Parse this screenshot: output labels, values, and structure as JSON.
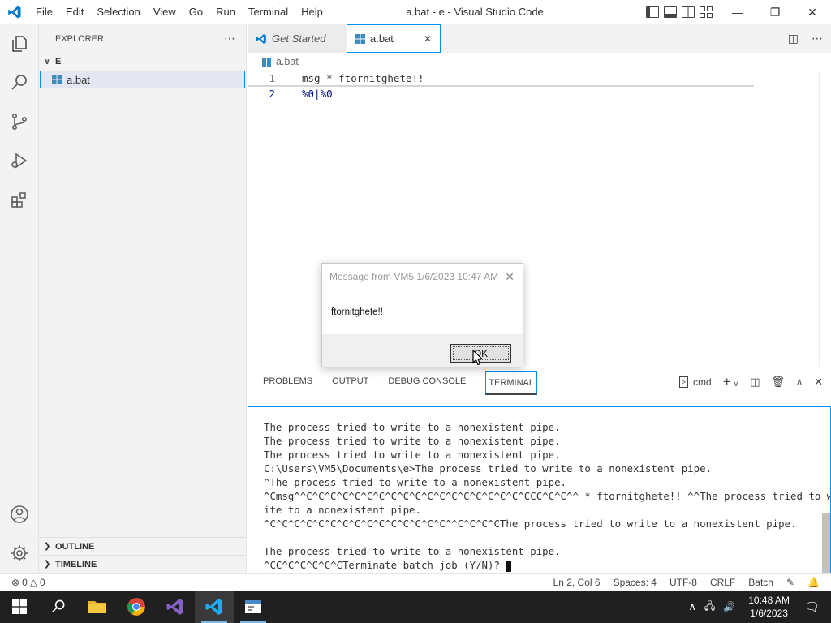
{
  "titlebar": {
    "menu": [
      "File",
      "Edit",
      "Selection",
      "View",
      "Go",
      "Run",
      "Terminal",
      "Help"
    ],
    "window_title": "a.bat - e - Visual Studio Code"
  },
  "sidebar": {
    "header": "EXPLORER",
    "folder": "E",
    "file": "a.bat",
    "outline": "OUTLINE",
    "timeline": "TIMELINE"
  },
  "tabs": [
    {
      "label": "Get Started"
    },
    {
      "label": "a.bat"
    }
  ],
  "breadcrumb": "a.bat",
  "editor": {
    "lines": [
      {
        "num": "1",
        "text": "msg * ftornitghete!!"
      },
      {
        "num": "2",
        "text": "%0|%0"
      }
    ]
  },
  "dialog": {
    "title": "Message from VM5 1/6/2023 10:47 AM",
    "message": "ftornitghete!!",
    "ok": "OK"
  },
  "panel": {
    "tabs": [
      "PROBLEMS",
      "OUTPUT",
      "DEBUG CONSOLE",
      "TERMINAL"
    ],
    "shell": "cmd",
    "terminal_lines": [
      "The process tried to write to a nonexistent pipe.",
      "The process tried to write to a nonexistent pipe.",
      "The process tried to write to a nonexistent pipe.",
      "C:\\Users\\VM5\\Documents\\e>The process tried to write to a nonexistent pipe.",
      "^The process tried to write to a nonexistent pipe.",
      "^Cmsg^^C^C^C^C^C^C^C^C^C^C^C^C^C^C^C^C^C^C^CCC^C^C^^ * ftornitghete!! ^^The process tried to wr",
      "ite to a nonexistent pipe.",
      "^C^C^C^C^C^C^C^C^C^C^C^C^C^C^C^^C^C^C^CThe process tried to write to a nonexistent pipe.",
      "",
      "The process tried to write to a nonexistent pipe.",
      "^CC^C^C^C^C^CTerminate batch job (Y/N)? "
    ]
  },
  "status": {
    "errors": "0",
    "warnings": "0",
    "position": "Ln 2, Col 6",
    "spaces": "Spaces: 4",
    "encoding": "UTF-8",
    "eol": "CRLF",
    "language": "Batch"
  },
  "taskbar": {
    "time": "10:48 AM",
    "date": "1/6/2023"
  },
  "colors": {
    "accent": "#0090f1",
    "vscode_blue": "#007acc",
    "taskbar": "#202020"
  }
}
